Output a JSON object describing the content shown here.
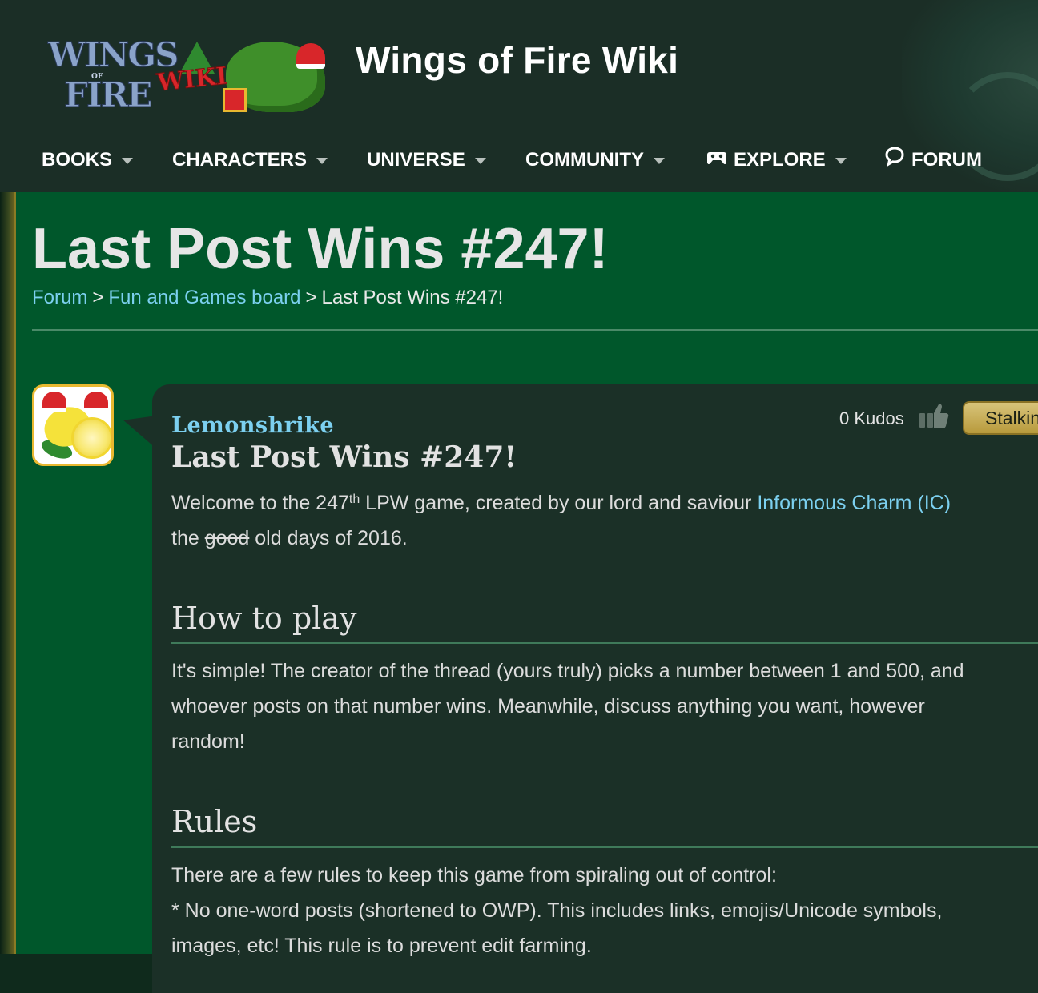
{
  "site": {
    "title": "Wings of Fire Wiki",
    "logo_text_line1": "WINGS",
    "logo_text_of": "OF",
    "logo_text_line2": "FIRE",
    "logo_wiki_word": "WIKI"
  },
  "nav": {
    "items": [
      {
        "label": "BOOKS",
        "has_dropdown": true
      },
      {
        "label": "CHARACTERS",
        "has_dropdown": true
      },
      {
        "label": "UNIVERSE",
        "has_dropdown": true
      },
      {
        "label": "COMMUNITY",
        "has_dropdown": true
      },
      {
        "label": "EXPLORE",
        "has_dropdown": true,
        "icon": "gamepad-icon"
      },
      {
        "label": "FORUM",
        "has_dropdown": false,
        "icon": "speech-bubble-icon"
      }
    ]
  },
  "page": {
    "title": "Last Post Wins #247!",
    "breadcrumb": {
      "forum": "Forum",
      "sep": ">",
      "board": "Fun and Games board",
      "current": "Last Post Wins #247!"
    }
  },
  "post": {
    "author": "Lemonshrike",
    "title": "Last Post Wins #247!",
    "kudos_label": "0 Kudos",
    "stalk_button": "Stalking",
    "intro": {
      "part1": "Welcome to the 247",
      "sup": "th",
      "part2": " LPW game, created by our lord and saviour ",
      "link": "Informous Charm (IC)",
      "part3": "the ",
      "struck": "good",
      "part4": " old days of 2016."
    },
    "how_to_play": {
      "heading": "How to play",
      "line1": "It's simple! The creator of the thread (yours truly) picks a number between 1 and 500, and",
      "line2": "whoever posts on that number wins. Meanwhile, discuss anything you want, however",
      "line3": "random!"
    },
    "rules": {
      "heading": "Rules",
      "line1": "There are a few rules to keep this game from spiraling out of control:",
      "line2": "* No one-word posts (shortened to OWP). This includes links, emojis/Unicode symbols,",
      "line3": "images, etc! This rule is to prevent edit farming."
    }
  },
  "colors": {
    "header_bg": "#1b2e26",
    "content_bg": "#00572b",
    "post_bg": "#1b3027",
    "link": "#7cd0f0",
    "button_gold": "#d8c47a"
  }
}
